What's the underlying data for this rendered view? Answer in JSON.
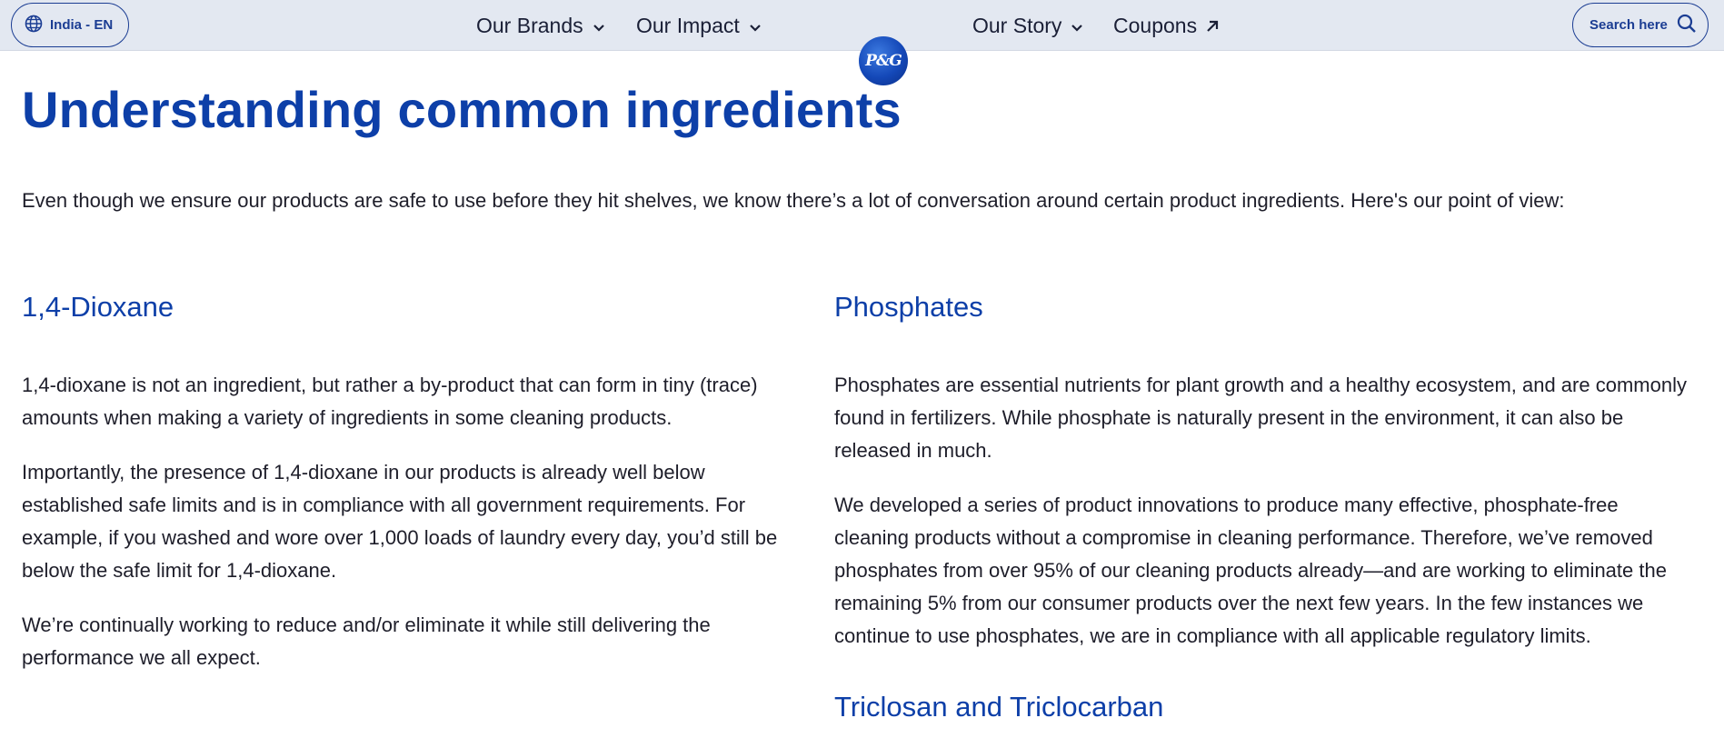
{
  "header": {
    "locale_label": "India - EN",
    "nav": [
      {
        "label": "Our Brands"
      },
      {
        "label": "Our Impact"
      },
      {
        "label": "Our Story"
      },
      {
        "label": "Coupons"
      }
    ],
    "logo_text": "P&G",
    "search_label": "Search here"
  },
  "main": {
    "title": "Understanding common ingredients",
    "intro": "Even though we ensure our products are safe to use before they hit shelves, we know there’s a lot of conversation around certain product ingredients. Here's our point of view:",
    "left": {
      "heading": "1,4-Dioxane",
      "paragraphs": [
        "1,4-dioxane is not an ingredient, but rather a by-product that can form in tiny (trace) amounts when making a variety of ingredients in some cleaning products.",
        "Importantly, the presence of 1,4-dioxane in our products is already well below established safe limits and is in compliance with all government requirements. For example, if you washed and wore over 1,000 loads of laundry every day, you’d still be below the safe limit for 1,4-dioxane.",
        "We’re continually working to reduce and/or eliminate it while still delivering the performance we all expect."
      ]
    },
    "right": {
      "heading": "Phosphates",
      "paragraphs": [
        "Phosphates are essential nutrients for plant growth and a healthy ecosystem, and are commonly found in fertilizers. While phosphate is naturally present in the environment, it can also be released in much.",
        "We developed a series of product innovations to produce many effective, phosphate-free cleaning products without a compromise in cleaning performance. Therefore, we’ve removed phosphates from over 95% of our cleaning products already—and are working to eliminate the remaining 5% from our consumer products over the next few years. In the few instances we continue to use phosphates, we are in compliance with all applicable regulatory limits."
      ],
      "next_heading": "Triclosan and Triclocarban"
    }
  },
  "colors": {
    "brand_blue": "#0d3fa8",
    "topbar_bg": "#e3e8f1"
  }
}
